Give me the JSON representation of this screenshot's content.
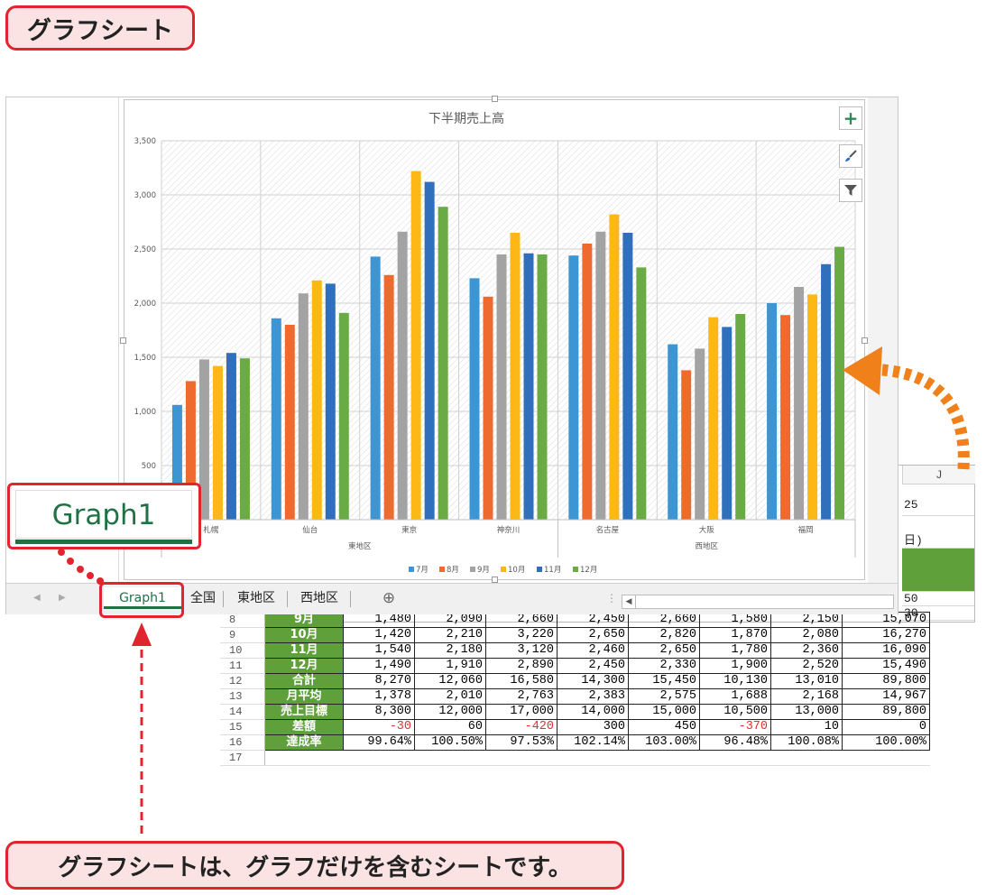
{
  "callouts": {
    "title": "グラフシート",
    "caption": "グラフシートは、グラフだけを含むシートです。"
  },
  "chart_data": {
    "type": "bar",
    "title": "下半期売上高",
    "categories": [
      "札幌",
      "仙台",
      "東京",
      "神奈川",
      "名古屋",
      "大阪",
      "福岡"
    ],
    "groups": [
      {
        "name": "東地区",
        "categories": [
          "札幌",
          "仙台",
          "東京",
          "神奈川"
        ]
      },
      {
        "name": "西地区",
        "categories": [
          "名古屋",
          "大阪",
          "福岡"
        ]
      }
    ],
    "series": [
      {
        "name": "7月",
        "color": "#3e95d3",
        "values": [
          1060,
          1860,
          2430,
          2230,
          2440,
          1620,
          2000
        ]
      },
      {
        "name": "8月",
        "color": "#ee6a2f",
        "values": [
          1280,
          1800,
          2260,
          2060,
          2550,
          1380,
          1890
        ]
      },
      {
        "name": "9月",
        "color": "#a3a3a3",
        "values": [
          1480,
          2090,
          2660,
          2450,
          2660,
          1580,
          2150
        ]
      },
      {
        "name": "10月",
        "color": "#fdb816",
        "values": [
          1420,
          2210,
          3220,
          2650,
          2820,
          1870,
          2080
        ]
      },
      {
        "name": "11月",
        "color": "#2f6fbc",
        "values": [
          1540,
          2180,
          3120,
          2460,
          2650,
          1780,
          2360
        ]
      },
      {
        "name": "12月",
        "color": "#6aab45",
        "values": [
          1490,
          1910,
          2890,
          2450,
          2330,
          1900,
          2520
        ]
      }
    ],
    "ylim": [
      0,
      3500
    ],
    "yticks": [
      "500",
      "1,000",
      "1,500",
      "2,000",
      "2,500",
      "3,000",
      "3,500"
    ],
    "legend": "bottom",
    "grid": true
  },
  "sheet": {
    "col_header": "J",
    "edge_cells": [
      "25",
      "日)",
      "50",
      "30"
    ],
    "tabs": [
      "Graph1",
      "全国",
      "東地区",
      "西地区"
    ],
    "add_sheet": "⊕",
    "rows": [
      {
        "n": "8",
        "label": "9月",
        "vals": [
          "1,480",
          "2,090",
          "2,660",
          "2,450",
          "2,660",
          "1,580",
          "2,150",
          "15,070"
        ]
      },
      {
        "n": "9",
        "label": "10月",
        "vals": [
          "1,420",
          "2,210",
          "3,220",
          "2,650",
          "2,820",
          "1,870",
          "2,080",
          "16,270"
        ]
      },
      {
        "n": "10",
        "label": "11月",
        "vals": [
          "1,540",
          "2,180",
          "3,120",
          "2,460",
          "2,650",
          "1,780",
          "2,360",
          "16,090"
        ]
      },
      {
        "n": "11",
        "label": "12月",
        "vals": [
          "1,490",
          "1,910",
          "2,890",
          "2,450",
          "2,330",
          "1,900",
          "2,520",
          "15,490"
        ]
      },
      {
        "n": "12",
        "label": "合計",
        "vals": [
          "8,270",
          "12,060",
          "16,580",
          "14,300",
          "15,450",
          "10,130",
          "13,010",
          "89,800"
        ]
      },
      {
        "n": "13",
        "label": "月平均",
        "vals": [
          "1,378",
          "2,010",
          "2,763",
          "2,383",
          "2,575",
          "1,688",
          "2,168",
          "14,967"
        ]
      },
      {
        "n": "14",
        "label": "売上目標",
        "vals": [
          "8,300",
          "12,000",
          "17,000",
          "14,000",
          "15,000",
          "10,500",
          "13,000",
          "89,800"
        ]
      },
      {
        "n": "15",
        "label": "差額",
        "vals": [
          "-30",
          "60",
          "-420",
          "300",
          "450",
          "-370",
          "10",
          "0"
        ]
      },
      {
        "n": "16",
        "label": "達成率",
        "vals": [
          "99.64%",
          "100.50%",
          "97.53%",
          "102.14%",
          "103.00%",
          "96.48%",
          "100.08%",
          "100.00%"
        ]
      }
    ],
    "last_row": "17"
  },
  "colors": {
    "accent_red": "#e0252f",
    "excel_green": "#207245",
    "label_green": "#5fa03a",
    "arrow_orange": "#f0801a"
  }
}
